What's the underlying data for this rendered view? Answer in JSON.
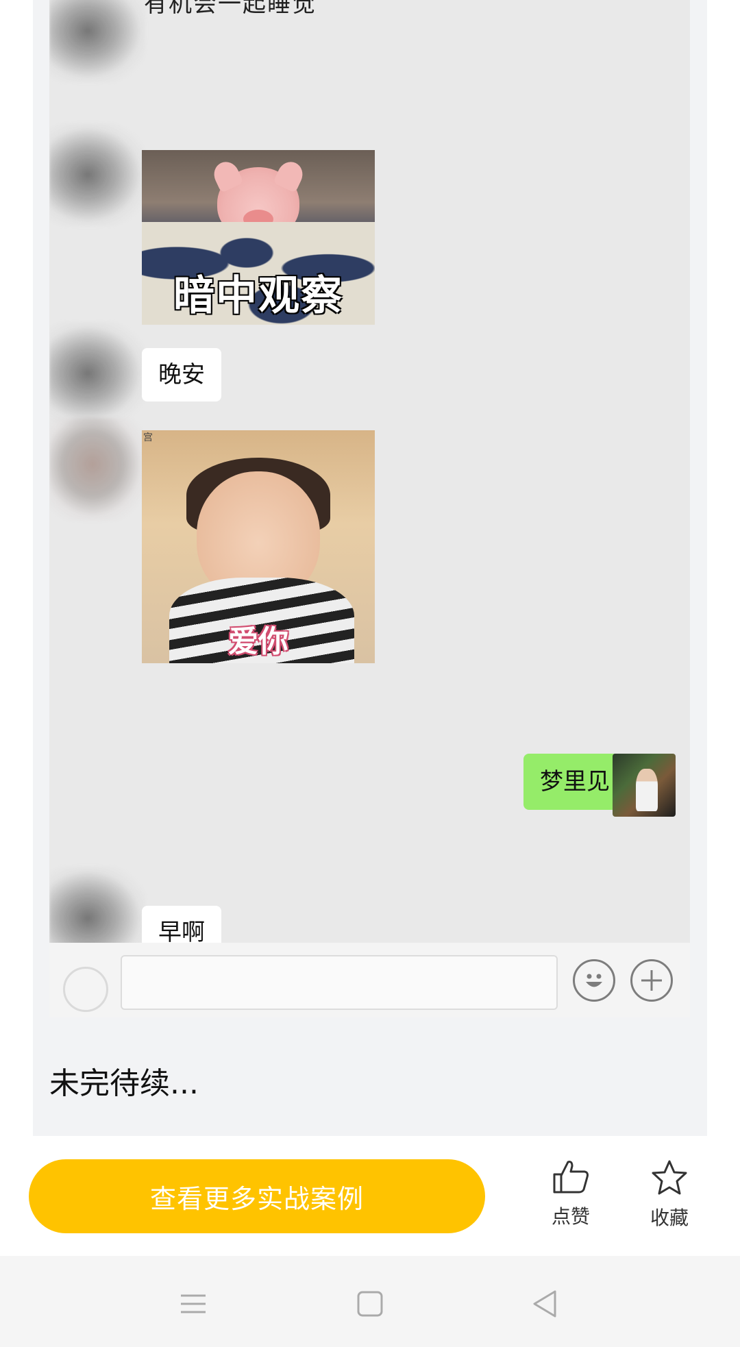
{
  "chat": {
    "cut_top_text": "有机会一起睡觉",
    "pig_sticker_caption": "暗中观察",
    "goodnight_bubble": "晚安",
    "girl_sticker_mark": "宫",
    "girl_sticker_caption": "爱你",
    "my_reply_bubble": "梦里见",
    "cut_bottom_bubble": "早啊"
  },
  "caption": "未完待续...",
  "bottom_bar": {
    "cta_label": "查看更多实战案例",
    "like_label": "点赞",
    "favorite_label": "收藏",
    "accent_color": "#ffc300"
  },
  "colors": {
    "my_bubble": "#95ec69",
    "chat_background": "#e9e9e9"
  }
}
